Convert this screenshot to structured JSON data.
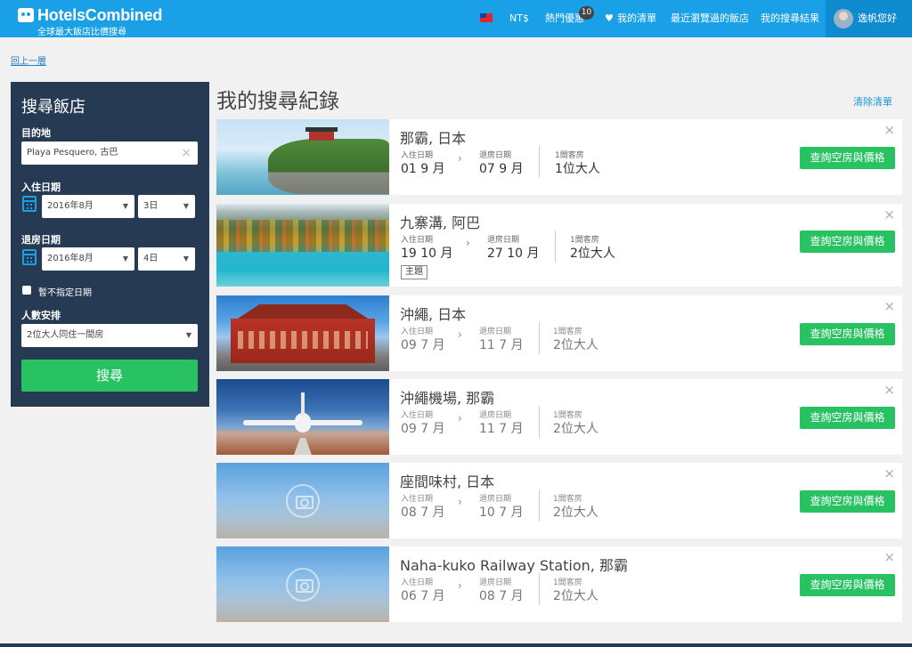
{
  "header": {
    "logo_name": "HotelsCombined",
    "logo_tagline": "全球最大飯店比價搜尋",
    "currency": "NT$",
    "deals_label": "熱門優惠",
    "deals_count": "10",
    "wishlist_label": "我的清單",
    "recent_label": "最近瀏覽過的飯店",
    "results_label": "我的搜尋結果",
    "user_greeting": "逸帆您好",
    "brand_color": "#1aa0e6"
  },
  "back_link": "回上一層",
  "sidebar": {
    "title": "搜尋飯店",
    "destination_label": "目的地",
    "destination_value": "Playa Pesquero, 古巴",
    "checkin_label": "入住日期",
    "checkin_month": "2016年8月",
    "checkin_day": "3日",
    "checkout_label": "退房日期",
    "checkout_month": "2016年8月",
    "checkout_day": "4日",
    "flexible_label": "暫不指定日期",
    "guests_label": "人數安排",
    "guests_value": "2位大人同住一間房",
    "search_button": "搜尋"
  },
  "main": {
    "title": "我的搜尋紀錄",
    "clear_label": "清除清單",
    "checkin_label": "入住日期",
    "checkout_label": "退房日期",
    "book_button": "查詢空房與價格",
    "items": [
      {
        "city": "那霸, 日本",
        "checkin": "01 9 月",
        "checkout": "07 9 月",
        "rooms": "1間客房",
        "guests": "1位大人"
      },
      {
        "city": "九寨溝, 阿巴",
        "checkin": "19 10 月",
        "checkout": "27 10 月",
        "rooms": "1間客房",
        "guests": "2位大人",
        "tag": "主題"
      },
      {
        "city": "沖繩, 日本",
        "checkin": "09 7 月",
        "checkout": "11 7 月",
        "rooms": "1間客房",
        "guests": "2位大人"
      },
      {
        "city": "沖繩機場, 那霸",
        "checkin": "09 7 月",
        "checkout": "11 7 月",
        "rooms": "1間客房",
        "guests": "2位大人"
      },
      {
        "city": "座間味村, 日本",
        "checkin": "08 7 月",
        "checkout": "10 7 月",
        "rooms": "1間客房",
        "guests": "2位大人"
      },
      {
        "city": "Naha-kuko Railway Station, 那霸",
        "checkin": "06 7 月",
        "checkout": "08 7 月",
        "rooms": "1間客房",
        "guests": "2位大人"
      }
    ]
  }
}
